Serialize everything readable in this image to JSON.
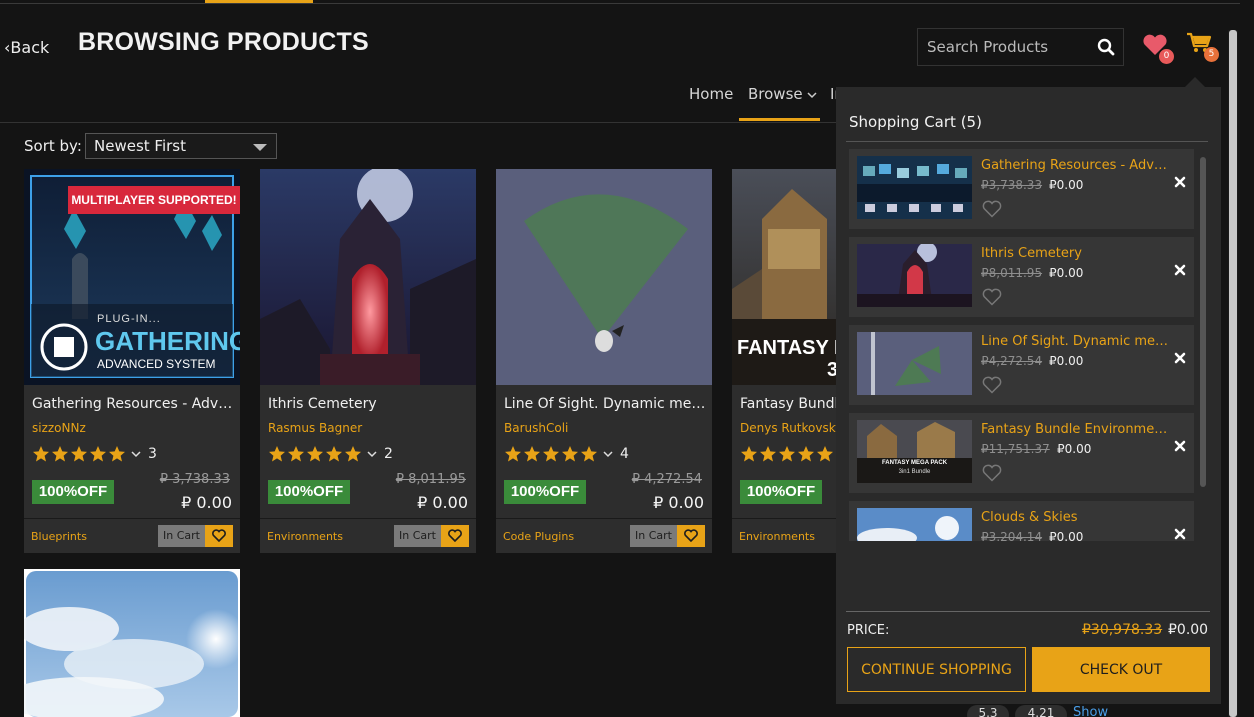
{
  "header": {
    "back_label": "Back",
    "title": "BROWSING PRODUCTS",
    "search_placeholder": "Search Products",
    "wishlist_count": "0",
    "cart_count": "5"
  },
  "nav": {
    "items": [
      {
        "label": "Home"
      },
      {
        "label": "Browse"
      },
      {
        "label": "In"
      }
    ]
  },
  "sort": {
    "label": "Sort by:",
    "selected": "Newest First"
  },
  "products": [
    {
      "name": "Gathering Resources - Advanced System",
      "author": "sizzoNNz",
      "rating_count": "3",
      "discount": "100%OFF",
      "old_price": "₽ 3,738.33",
      "new_price": "₽ 0.00",
      "category": "Blueprints",
      "cart_label": "In Cart",
      "banner": "MULTIPLAYER SUPPORTED!",
      "logo_line1": "PLUG-IN...",
      "logo_line2": "GATHERING",
      "logo_line3": "ADVANCED SYSTEM"
    },
    {
      "name": "Ithris Cemetery",
      "author": "Rasmus Bagner",
      "rating_count": "2",
      "discount": "100%OFF",
      "old_price": "₽ 8,011.95",
      "new_price": "₽ 0.00",
      "category": "Environments",
      "cart_label": "In Cart"
    },
    {
      "name": "Line Of Sight. Dynamic mesh.",
      "author": "BarushColi",
      "rating_count": "4",
      "discount": "100%OFF",
      "old_price": "₽ 4,272.54",
      "new_price": "₽ 0.00",
      "category": "Code Plugins",
      "cart_label": "In Cart"
    },
    {
      "name": "Fantasy Bundle Environment",
      "author": "Denys Rutkovsky",
      "rating_count": "",
      "discount": "100%OFF",
      "old_price": "",
      "new_price": "",
      "category": "Environments",
      "cart_label": "",
      "image_text_1": "FANTASY M",
      "image_text_2": "3"
    }
  ],
  "cart": {
    "title": "Shopping Cart (5)",
    "items": [
      {
        "name": "Gathering Resources - Advanced System",
        "old_price": "₽3,738.33",
        "new_price": "₽0.00"
      },
      {
        "name": "Ithris Cemetery",
        "old_price": "₽8,011.95",
        "new_price": "₽0.00"
      },
      {
        "name": "Line Of Sight. Dynamic mesh.",
        "old_price": "₽4,272.54",
        "new_price": "₽0.00"
      },
      {
        "name": "Fantasy Bundle Environment Mega Pack",
        "old_price": "₽11,751.37",
        "new_price": "₽0.00",
        "thumb_text_1": "FANTASY MEGA PACK",
        "thumb_text_2": "3in1 Bundle"
      },
      {
        "name": "Clouds & Skies",
        "old_price": "₽3,204.14",
        "new_price": "₽0.00"
      }
    ],
    "price_label": "PRICE:",
    "total_old": "₽30,978.33",
    "total_new": "₽0.00",
    "continue_label": "CONTINUE SHOPPING",
    "checkout_label": "CHECK OUT"
  },
  "footer_peek": {
    "pill_1": "5.3",
    "pill_2": "4.21",
    "show_label": "Show"
  },
  "colors": {
    "accent": "#e8a317",
    "background": "#141414",
    "card": "#2d2d2d",
    "discount_green": "#3a8b3a",
    "badge_orange": "#e8713a"
  }
}
